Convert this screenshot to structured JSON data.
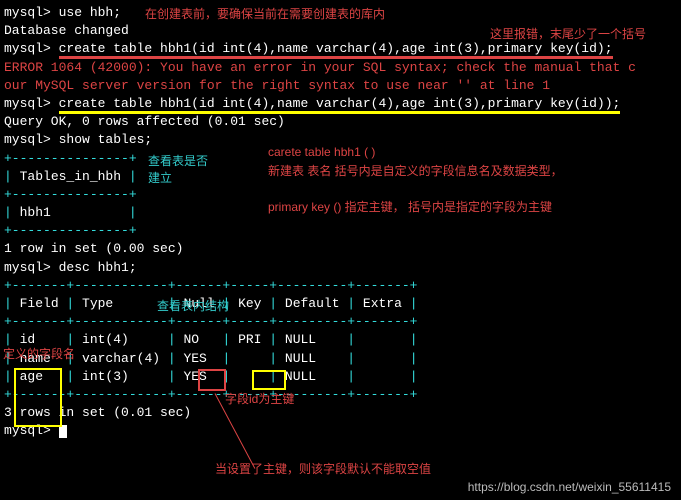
{
  "lines": {
    "l1_prompt": "mysql> ",
    "l1_cmd": "use hbh;",
    "l2": "Database changed",
    "l3_prompt": "mysql> ",
    "l3_cmd": "create table hbh1(id int(4),name varchar(4),age int(3),primary key(id);",
    "l4": "ERROR 1064 (42000): You have an error in your SQL syntax; check the manual that c",
    "l5": "our MySQL server version for the right syntax to use near '' at line 1",
    "l6_prompt": "mysql> ",
    "l6_cmd": "create table hbh1(id int(4),name varchar(4),age int(3),primary key(id));",
    "l7": "Query OK, 0 rows affected (0.01 sec)",
    "l8": "",
    "l9_prompt": "mysql> ",
    "l9_cmd": "show tables;",
    "l10": "+---------------+",
    "l11": "| Tables_in_hbh |",
    "l12": "+---------------+",
    "l13": "| hbh1          |",
    "l14": "+---------------+",
    "l15": "1 row in set (0.00 sec)",
    "l16": "",
    "l17_prompt": "mysql> ",
    "l17_cmd": "desc hbh1;",
    "l18": "+-------+------------+------+-----+---------+-------+",
    "l19": "| Field | Type       | Null | Key | Default | Extra |",
    "l20": "+-------+------------+------+-----+---------+-------+",
    "l21": "| id    | int(4)     | NO   | PRI | NULL    |       |",
    "l22": "| name  | varchar(4) | YES  |     | NULL    |       |",
    "l23": "| age   | int(3)     | YES  |     | NULL    |       |",
    "l24": "+-------+------------+------+-----+---------+-------+",
    "l25": "3 rows in set (0.01 sec)",
    "l26": "",
    "l27_prompt": "mysql> "
  },
  "annotations": {
    "a1": "在创建表前，要确保当前在需要创建表的库内",
    "a2": "这里报错，末尾少了一个括号",
    "a3": "查看表是否建立",
    "a4_line1": "carete table  hbh1  (                                    )",
    "a4_line2": "新建表          表名   括号内是自定义的字段信息名及数据类型，",
    "a4_line3": "primary key () 指定主键， 括号内是指定的字段为主键",
    "a5": "查看表内结构",
    "a6": "定义的字段名",
    "a7": "当设置了主键，则该字段默认不能取空值",
    "a8": "字段id为主键"
  },
  "watermark": "https://blog.csdn.net/weixin_55611415",
  "chart_data": {
    "type": "table",
    "title": "desc hbh1",
    "columns": [
      "Field",
      "Type",
      "Null",
      "Key",
      "Default",
      "Extra"
    ],
    "rows": [
      [
        "id",
        "int(4)",
        "NO",
        "PRI",
        "NULL",
        ""
      ],
      [
        "name",
        "varchar(4)",
        "YES",
        "",
        "NULL",
        ""
      ],
      [
        "age",
        "int(3)",
        "YES",
        "",
        "NULL",
        ""
      ]
    ]
  }
}
